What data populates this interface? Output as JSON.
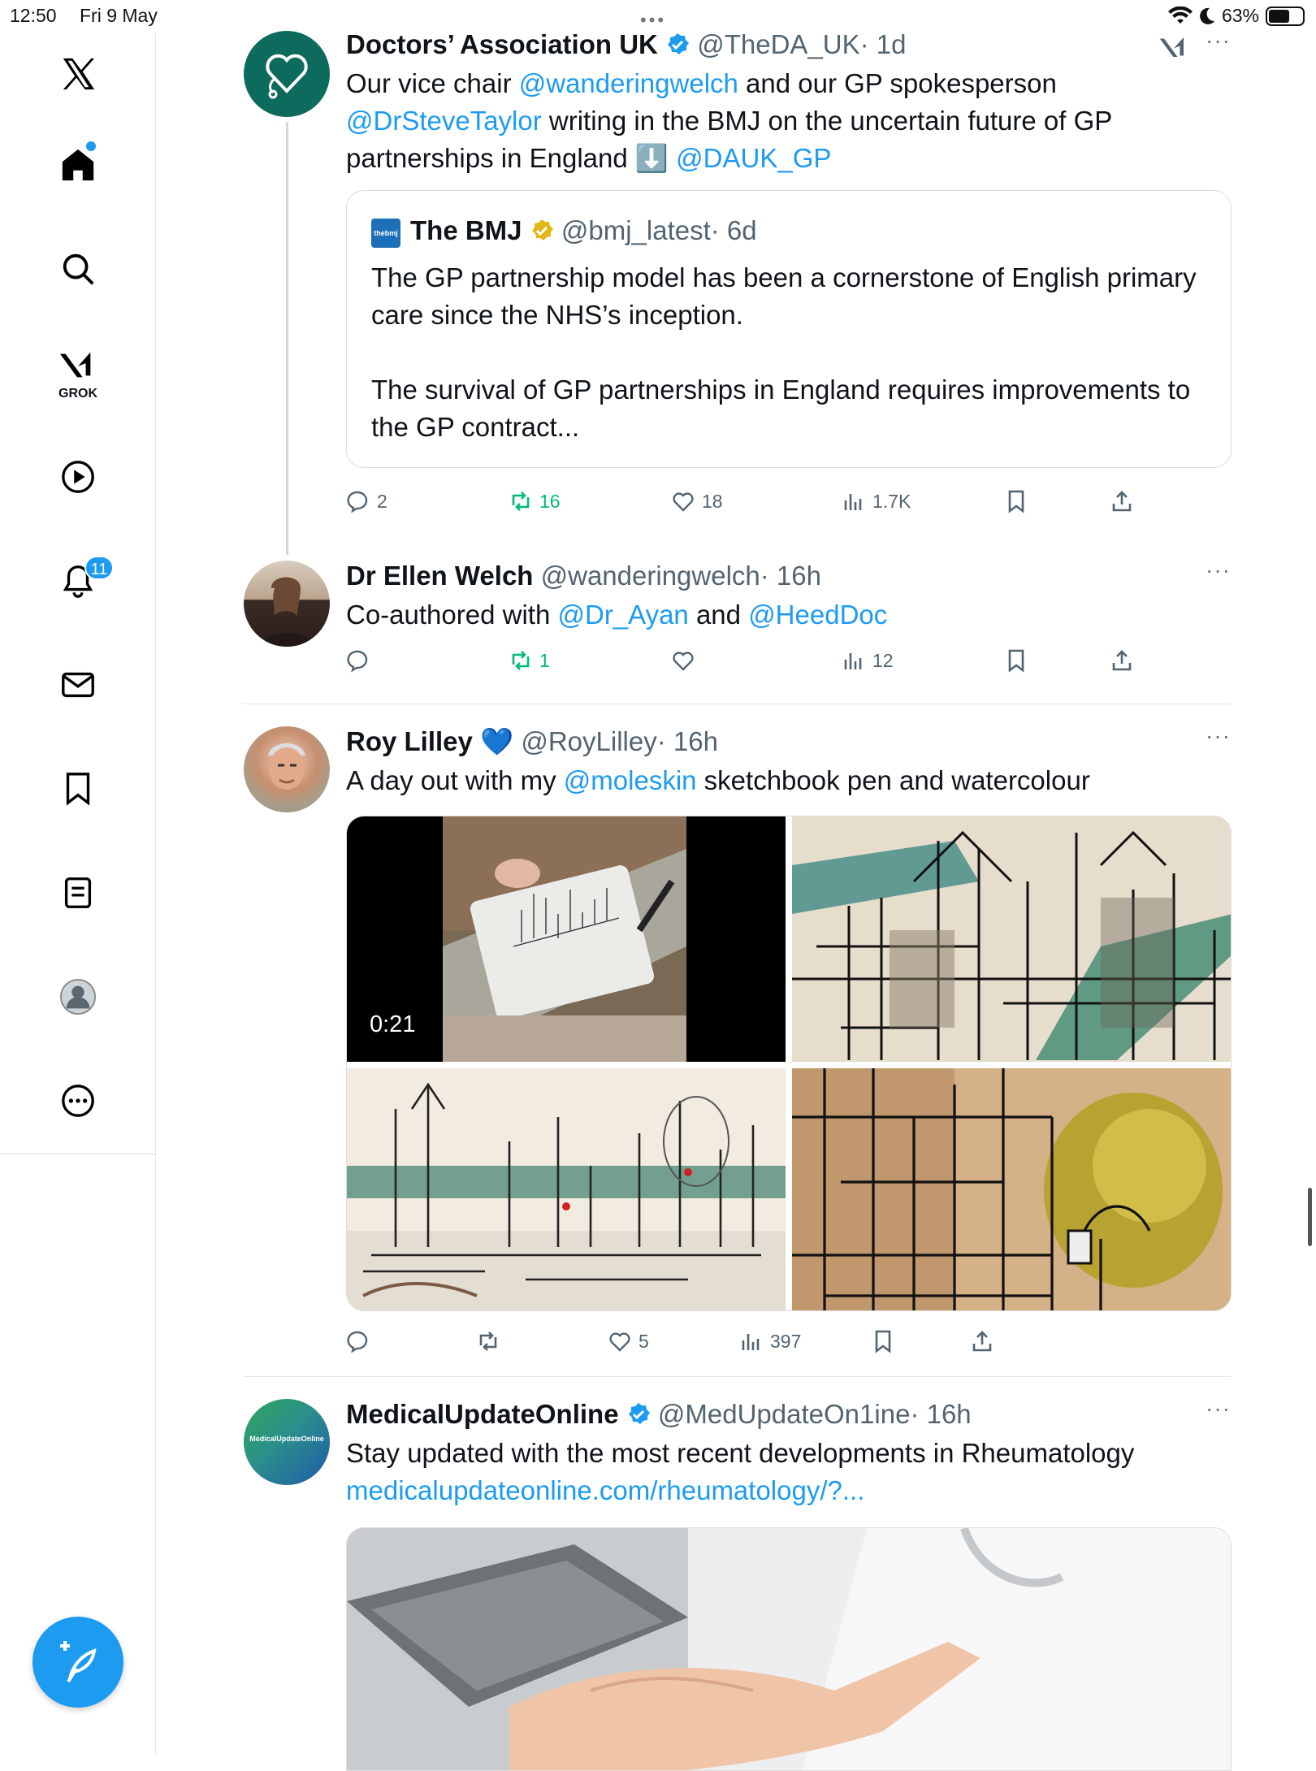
{
  "status_bar": {
    "time": "12:50",
    "date": "Fri 9 May",
    "battery": "63%"
  },
  "sidebar": {
    "items": [
      {
        "name": "home"
      },
      {
        "name": "explore"
      },
      {
        "name": "grok",
        "label": "GROK"
      },
      {
        "name": "videos"
      },
      {
        "name": "notifications",
        "badge": "11"
      },
      {
        "name": "messages"
      },
      {
        "name": "bookmarks"
      },
      {
        "name": "lists"
      },
      {
        "name": "profile"
      },
      {
        "name": "more"
      }
    ]
  },
  "posts": [
    {
      "display_name": "Doctors’ Association UK",
      "verified": "blue",
      "handle": "@TheDA_UK",
      "time": "· 1d",
      "text_parts": [
        "Our vice chair ",
        "@wanderingwelch",
        " and our GP spokesperson ",
        "@DrSteveTaylor",
        " writing in the BMJ on the uncertain future of GP partnerships in England ",
        "⬇️",
        " ",
        "@DAUK_GP"
      ],
      "quote": {
        "avatar_text": "thebmj",
        "display_name": "The BMJ",
        "handle": "@bmj_latest",
        "time": "· 6d",
        "para1": "The GP partnership model has been a cornerstone of English primary care since the NHS’s inception.",
        "para2": "The survival of GP partnerships in England requires improvements to the GP contract..."
      },
      "replies": "2",
      "reposts": "16",
      "likes": "18",
      "views": "1.7K"
    },
    {
      "display_name": "Dr Ellen Welch",
      "handle": "@wanderingwelch",
      "time": "· 16h",
      "text_parts": [
        "Co-authored with ",
        "@Dr_Ayan",
        " and ",
        "@HeedDoc"
      ],
      "replies": "",
      "reposts": "1",
      "likes": "",
      "views": "12"
    },
    {
      "display_name": "Roy Lilley",
      "emoji": "💙",
      "handle": "@RoyLilley",
      "time": "· 16h",
      "text_parts": [
        "A day out with my ",
        "@moleskin",
        " sketchbook pen and watercolour"
      ],
      "video_duration": "0:21",
      "replies": "",
      "reposts": "",
      "likes": "5",
      "views": "397"
    },
    {
      "display_name": "MedicalUpdateOnline",
      "verified": "blue",
      "handle": "@MedUpdateOn1ine",
      "time": "· 16h",
      "avatar_text": "MedicalUpdateOnline",
      "text": "Stay updated with the most recent developments in Rheumatology",
      "url": "medicalupdateonline.com/rheumatology/?..."
    }
  ],
  "colors": {
    "accent": "#1d9bf0",
    "repost_active": "#00ba7c",
    "dauk_avatar": "#0d6b5d"
  }
}
